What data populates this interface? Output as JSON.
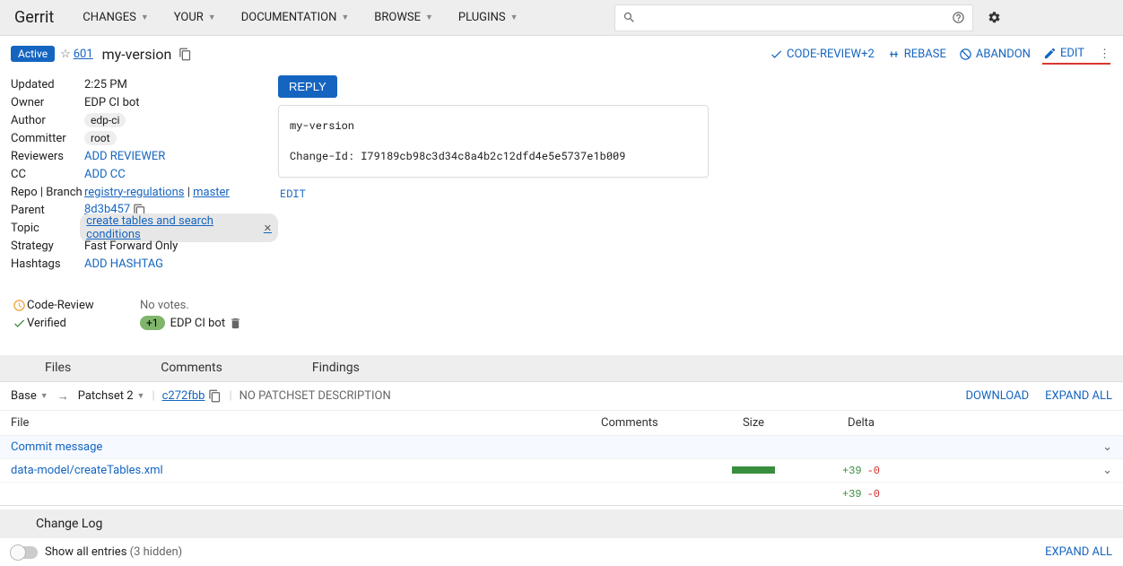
{
  "brand": "Gerrit",
  "nav": [
    "CHANGES",
    "YOUR",
    "DOCUMENTATION",
    "BROWSE",
    "PLUGINS"
  ],
  "subhead": {
    "status": "Active",
    "change_number": "601",
    "title": "my-version"
  },
  "actions": {
    "code_review": "CODE-REVIEW+2",
    "rebase": "REBASE",
    "abandon": "ABANDON",
    "edit": "EDIT"
  },
  "meta": {
    "updated_label": "Updated",
    "updated_val": "2:25 PM",
    "owner_label": "Owner",
    "owner_val": "EDP CI bot",
    "author_label": "Author",
    "author_val": "edp-ci",
    "committer_label": "Committer",
    "committer_val": "root",
    "reviewers_label": "Reviewers",
    "reviewers_val": "ADD REVIEWER",
    "cc_label": "CC",
    "cc_val": "ADD CC",
    "repo_label": "Repo | Branch",
    "repo_val": "registry-regulations",
    "branch_val": "master",
    "parent_label": "Parent",
    "parent_val": "8d3b457",
    "topic_label": "Topic",
    "topic_val": "create tables and search conditions",
    "strategy_label": "Strategy",
    "strategy_val": "Fast Forward Only",
    "hashtags_label": "Hashtags",
    "hashtags_val": "ADD HASHTAG"
  },
  "votes": {
    "code_review_label": "Code-Review",
    "code_review_val": "No votes.",
    "verified_label": "Verified",
    "verified_chip": "+1",
    "verified_by": "EDP CI bot"
  },
  "reply_label": "REPLY",
  "commit_msg": {
    "line1": "my-version",
    "line2": "Change-Id: I79189cb98c3d34c8a4b2c12dfd4e5e5737e1b009"
  },
  "edit_link": "EDIT",
  "tabs": {
    "files": "Files",
    "comments": "Comments",
    "findings": "Findings"
  },
  "patchrow": {
    "base": "Base",
    "arrow": "→",
    "patchset": "Patchset 2",
    "sha": "c272fbb",
    "no_desc": "NO PATCHSET DESCRIPTION",
    "download": "DOWNLOAD",
    "expand_all": "EXPAND ALL"
  },
  "files": {
    "head_file": "File",
    "head_comments": "Comments",
    "head_size": "Size",
    "head_delta": "Delta",
    "commit_message": "Commit message",
    "f1_path": "data-model/createTables.xml",
    "f1_add": "+39",
    "f1_del": "-0",
    "total_add": "+39",
    "total_del": "-0"
  },
  "clog": {
    "title": "Change Log",
    "show_all": "Show all entries",
    "hidden": "(3 hidden)",
    "expand_all": "EXPAND ALL"
  }
}
